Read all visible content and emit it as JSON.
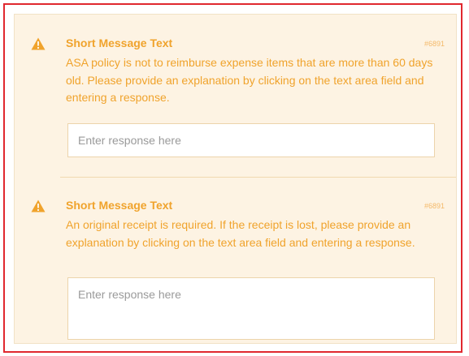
{
  "colors": {
    "frame_border": "#e0282f",
    "panel_background": "#fdf3e3",
    "accent": "#f0a32c",
    "code_text": "#f4b969",
    "input_border": "#ecd4ab",
    "placeholder": "#9a9a9a"
  },
  "alerts": [
    {
      "icon": "warning-triangle-icon",
      "title": "Short Message Text",
      "code": "#6891",
      "message": "ASA policy is not to reimburse expense items that are more than 60 days old. Please provide an explanation by clicking on the text area field and entering a response.",
      "response_placeholder": "Enter response here",
      "response_value": ""
    },
    {
      "icon": "warning-triangle-icon",
      "title": "Short Message Text",
      "code": "#6891",
      "message": "An original receipt is required. If the receipt is lost, please provide an explanation by clicking on the text area field and entering a response.",
      "response_placeholder": "Enter response here",
      "response_value": ""
    }
  ]
}
